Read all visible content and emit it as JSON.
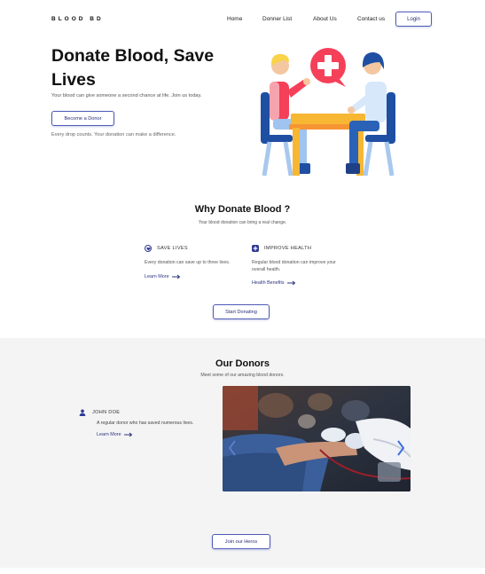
{
  "nav": {
    "brand": "BLOOD  BD",
    "links": [
      "Home",
      "Donner List",
      "About Us",
      "Contact us"
    ],
    "login": "Login"
  },
  "hero": {
    "title": "Donate Blood, Save Lives",
    "subtitle": "Your blood can give someone a second chance at life. Join us today.",
    "cta": "Become a Donor",
    "note": "Every drop counts. Your donation can make a difference."
  },
  "why": {
    "title": "Why Donate Blood ?",
    "subtitle": "Your blood donation can bring a real change.",
    "features": [
      {
        "heading": "SAVE LIVES",
        "desc": "Every donation can save up to three lives.",
        "link": "Learn More",
        "icon": "heart-circle-icon"
      },
      {
        "heading": "IMPROVE HEALTH",
        "desc": "Regular blood donation can improve your overall health.",
        "link": "Health Benefits",
        "icon": "plus-square-icon"
      }
    ],
    "cta": "Start Donating"
  },
  "donors": {
    "title": "Our Donors",
    "subtitle": "Meet some of our amazing blood donors.",
    "donor": {
      "name": "JOHN DOE",
      "desc": "A regular donor who has saved numerous lives.",
      "link": "Learn More"
    },
    "cta": "Join our Heros"
  },
  "colors": {
    "accent": "#2f3b94",
    "button_border": "#4f5bb8",
    "section_bg": "#f4f4f4"
  }
}
